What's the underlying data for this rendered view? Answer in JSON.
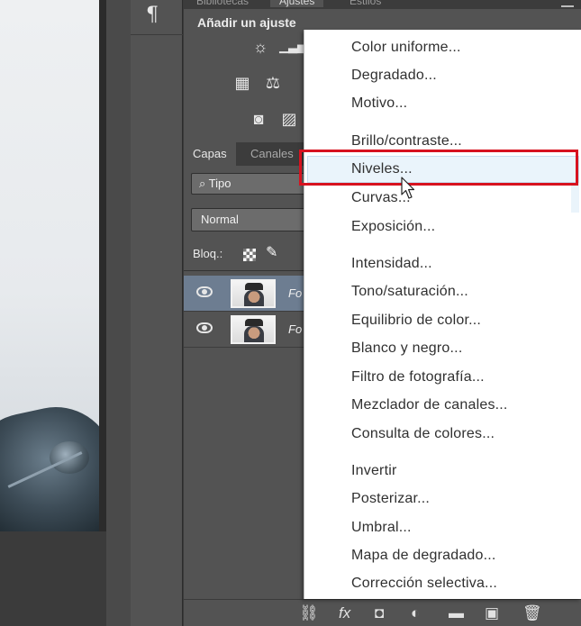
{
  "tool_column": {
    "pilcrow_glyph": "¶"
  },
  "top_tabs": [
    "Bibliotecas",
    "Ajustes",
    "Estilos"
  ],
  "adjustments": {
    "title": "Añadir un ajuste"
  },
  "layers_panel": {
    "tabs": [
      "Capas",
      "Canales"
    ],
    "filter_label": "Tipo",
    "blend_mode": "Normal",
    "lock_label": "Bloq.:",
    "layers": [
      {
        "name": "Fo",
        "selected": true
      },
      {
        "name": "Fo",
        "selected": false
      }
    ]
  },
  "menu": {
    "items": [
      "Color uniforme...",
      "Degradado...",
      "Motivo...",
      "Brillo/contraste...",
      "Niveles...",
      "Curvas...",
      "Exposición...",
      "Intensidad...",
      "Tono/saturación...",
      "Equilibrio de color...",
      "Blanco y negro...",
      "Filtro de fotografía...",
      "Mezclador de canales...",
      "Consulta de colores...",
      "Invertir",
      "Posterizar...",
      "Umbral...",
      "Mapa de degradado...",
      "Corrección selectiva..."
    ],
    "hovered_item": "Niveles...",
    "highlight_color": "#d7121f"
  },
  "bottom_bar_icons": [
    "link-icon",
    "fx-icon",
    "mask-icon",
    "adjustment-layer-icon",
    "folder-icon",
    "new-layer-icon",
    "trash-icon"
  ]
}
